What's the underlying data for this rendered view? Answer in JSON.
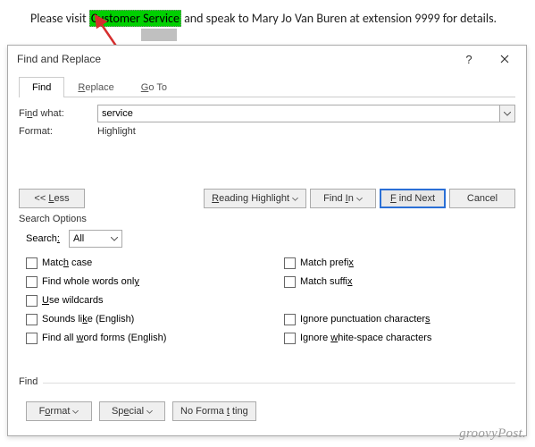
{
  "document": {
    "before": "Please visit",
    "highlighted": "Customer Service",
    "after": " and speak to Mary Jo Van Buren at extension 9999 for details."
  },
  "dialog": {
    "title": "Find and Replace",
    "help": "?",
    "tabs": {
      "find": "Find",
      "replace": "Replace",
      "goto": "Go To"
    },
    "findWhatLabel": "Find what:",
    "findWhatValue": "service",
    "formatLabel": "Format:",
    "formatValue": "Highlight",
    "buttons": {
      "less": "<< Less",
      "readingHighlight": "Reading Highlight",
      "findIn": "Find In",
      "findNext": "Find Next",
      "cancel": "Cancel"
    },
    "searchOptions": {
      "title": "Search Options",
      "searchLabel": "Search:",
      "searchValue": "All",
      "matchCase": "Match case",
      "wholeWords": "Find whole words only",
      "wildcards": "Use wildcards",
      "soundsLike": "Sounds like (English)",
      "allForms": "Find all word forms (English)",
      "matchPrefix": "Match prefix",
      "matchSuffix": "Match suffix",
      "ignorePunct": "Ignore punctuation characters",
      "ignoreWhite": "Ignore white-space characters"
    },
    "findSection": {
      "title": "Find",
      "format": "Format",
      "special": "Special",
      "noFormatting": "No Formatting"
    }
  },
  "attribution": "groovyPost."
}
